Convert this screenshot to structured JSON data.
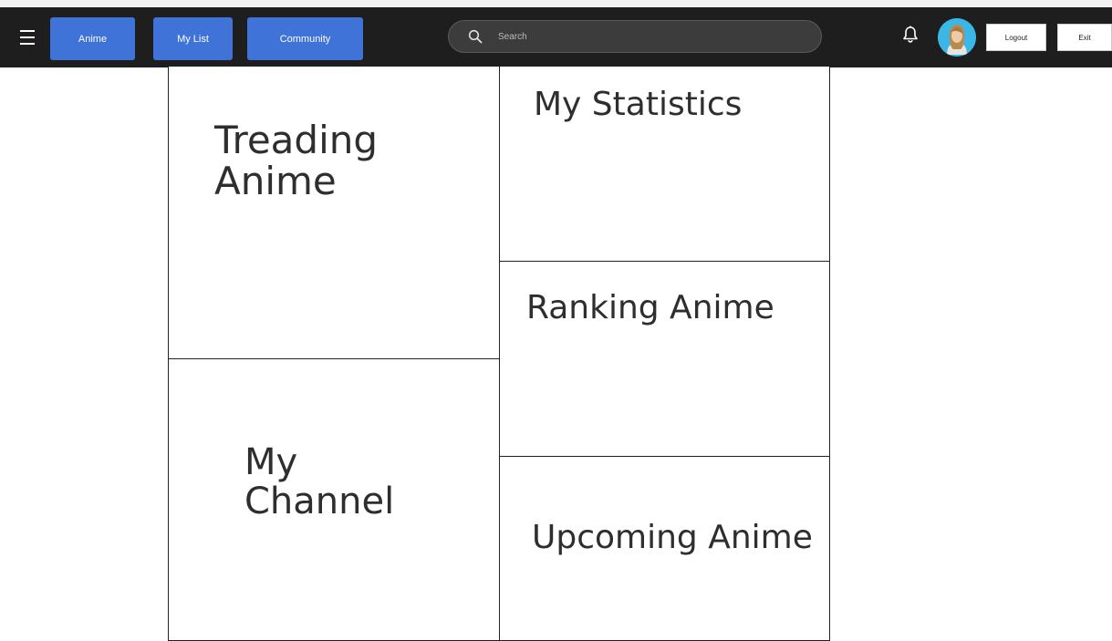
{
  "navbar": {
    "menu_icon": "hamburger-menu-icon",
    "buttons": {
      "anime": "Anime",
      "my_list": "My List",
      "community": "Community"
    },
    "search": {
      "placeholder": "Search",
      "icon": "search-icon"
    },
    "notification_icon": "bell-icon",
    "avatar": "user-avatar",
    "logout_label": "Logout",
    "exit_label": "Exit"
  },
  "panels": {
    "trending": "Treading Anime",
    "my_statistics": "My Statistics",
    "ranking": "Ranking Anime",
    "my_channel": "My Channel",
    "upcoming": "Upcoming Anime"
  },
  "colors": {
    "navbar_bg": "#1e1e1e",
    "accent_button": "#3f73d8",
    "avatar_bg": "#3ab7e6"
  }
}
